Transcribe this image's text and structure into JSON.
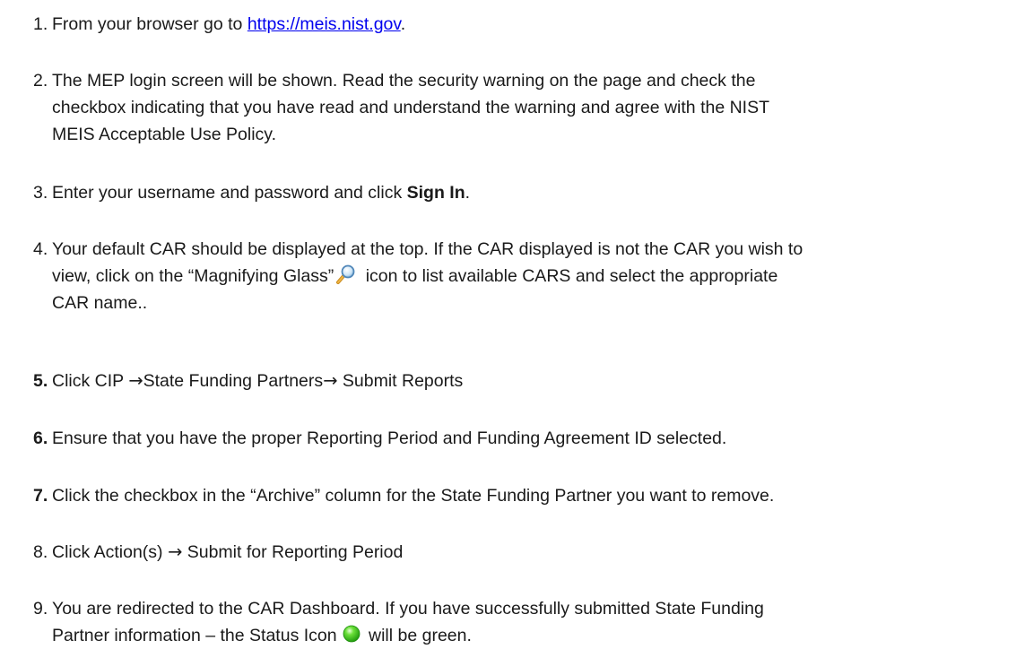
{
  "steps": [
    {
      "number": "1.",
      "pre": "From your browser go to ",
      "link": "https://meis.nist.gov",
      "post": "."
    },
    {
      "number": "2.",
      "line1": "The MEP login screen will be shown. Read the security warning on the page and check the",
      "line2": "checkbox indicating that you have read and understand the warning and agree with the NIST",
      "line3": "MEIS Acceptable Use Policy."
    },
    {
      "number": "3.",
      "pre": "Enter your username and password and click ",
      "bold": "Sign In",
      "post": "."
    },
    {
      "number": "4.",
      "line1": "Your default CAR should be displayed at the top. If the CAR displayed is not the CAR you wish to",
      "line2_pre": "view, click on the “Magnifying Glass”",
      "icon": "magnifying-glass-icon",
      "line2_post": " icon to list available CARS and select the appropriate",
      "line3": "CAR name.."
    },
    {
      "number": "5.",
      "part1": "Click CIP ",
      "arrow": "→",
      "part2": "State Funding Partners",
      "part3": " Submit Reports"
    },
    {
      "number": "6.",
      "text": "Ensure that you have the proper Reporting Period and Funding Agreement ID selected."
    },
    {
      "number": "7.",
      "text": "Click the checkbox in the “Archive” column for the State Funding Partner you want to remove."
    },
    {
      "number": "8.",
      "part1": "Click Action(s) ",
      "arrow": "→",
      "part2": " Submit for Reporting Period"
    },
    {
      "number": "9.",
      "line1": "You are redirected to the CAR Dashboard. If you have successfully submitted State Funding",
      "line2_pre": "Partner information – the Status Icon",
      "icon": "green-status-icon",
      "line2_post": " will be green."
    }
  ],
  "colors": {
    "text": "#1a1a1a",
    "link": "#0000ee",
    "status_green": "#33cc22"
  }
}
